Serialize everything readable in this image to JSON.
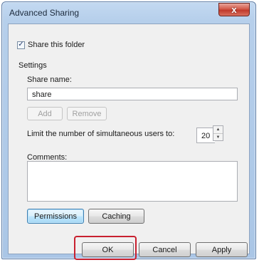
{
  "window": {
    "title": "Advanced Sharing",
    "close_glyph": "x"
  },
  "share_this_folder": {
    "label": "Share this folder",
    "checked": true
  },
  "settings": {
    "legend": "Settings",
    "share_name_label": "Share name:",
    "share_name_value": "share",
    "add_label": "Add",
    "remove_label": "Remove",
    "limit_label": "Limit the number of simultaneous users to:",
    "limit_value": "20",
    "comments_label": "Comments:",
    "comments_value": "",
    "permissions_label": "Permissions",
    "caching_label": "Caching"
  },
  "footer": {
    "ok_label": "OK",
    "cancel_label": "Cancel",
    "apply_label": "Apply"
  },
  "colors": {
    "highlight": "#c8202f",
    "title_bar": "#b6cfeb",
    "close_button": "#c0392b"
  }
}
